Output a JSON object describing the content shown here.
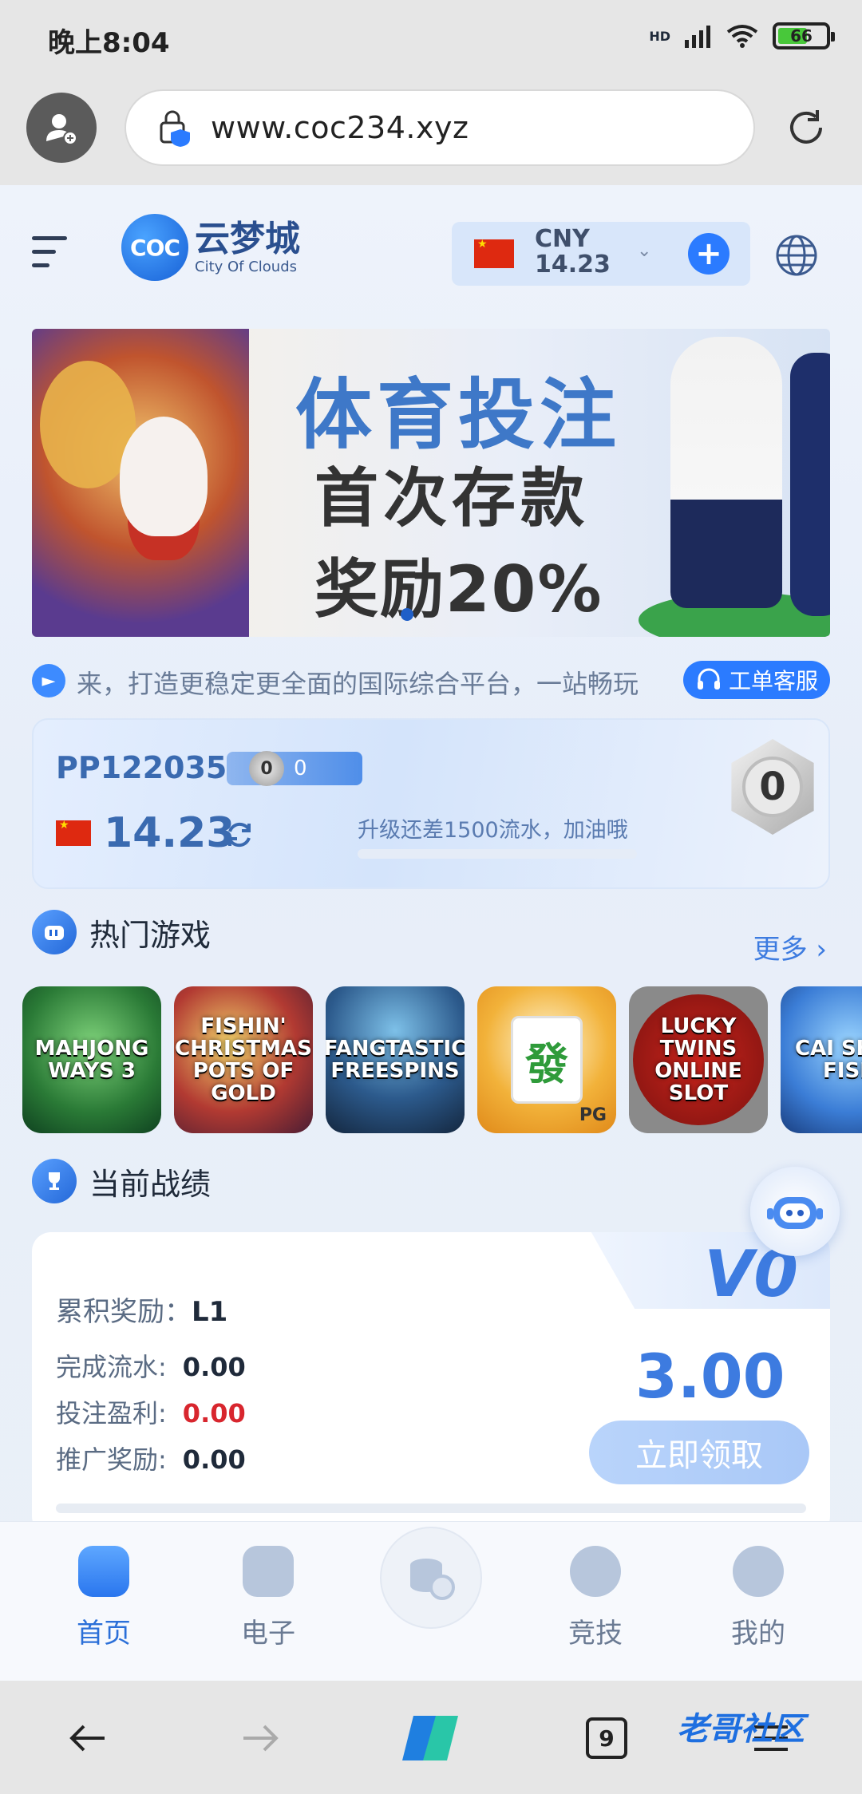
{
  "status_bar": {
    "time": "晚上8:04",
    "network": "HD",
    "battery": "66",
    "battery_level": 0.66
  },
  "browser": {
    "url": "www.coc234.xyz"
  },
  "header": {
    "logo_badge": "COC",
    "logo_cn": "云梦城",
    "logo_en": "City Of Clouds",
    "currency": "CNY",
    "balance": "14.23"
  },
  "banner": {
    "line1": "体育投注",
    "line2": "首次存款",
    "line3": "奖励20%"
  },
  "notice": {
    "text": "来，打造更稳定更全面的国际综合平台，一站畅玩",
    "support_label": "工单客服"
  },
  "account": {
    "user_id": "PP122035",
    "level_badge": "0",
    "level_value": "0",
    "balance": "14.23",
    "upgrade_text": "升级还差1500流水，加油哦",
    "upgrade_progress": 0,
    "medal_level": "0"
  },
  "hot_games": {
    "title": "热门游戏",
    "more_label": "更多",
    "items": [
      {
        "label": "MAHJONG WAYS 3"
      },
      {
        "label": "FISHIN' CHRISTMAS POTS OF GOLD"
      },
      {
        "label": "FANGTASTIC FREESPINS"
      },
      {
        "label": "發",
        "badge": "PG"
      },
      {
        "label": "LUCKY TWINS ONLINE SLOT"
      },
      {
        "label": "CAI SHEN FISH"
      }
    ]
  },
  "stats": {
    "title": "当前战绩",
    "vip": "V0",
    "accumulated_label": "累积奖励：",
    "accumulated_value": "L1",
    "turnover_label": "完成流水:",
    "turnover_value": "0.00",
    "profit_label": "投注盈利:",
    "profit_value": "0.00",
    "referral_label": "推广奖励:",
    "referral_value": "0.00",
    "reward_amount": "3.00",
    "claim_label": "立即领取"
  },
  "tabbar": {
    "items": [
      {
        "label": "首页",
        "active": true
      },
      {
        "label": "电子"
      },
      {
        "label": "竞技"
      },
      {
        "label": "我的"
      }
    ]
  },
  "system_nav": {
    "tabs_count": "9"
  },
  "watermark": "老哥社区",
  "colors": {
    "accent": "#2b7bff",
    "brand_blue": "#3d7be0",
    "loss_red": "#d8262e"
  }
}
